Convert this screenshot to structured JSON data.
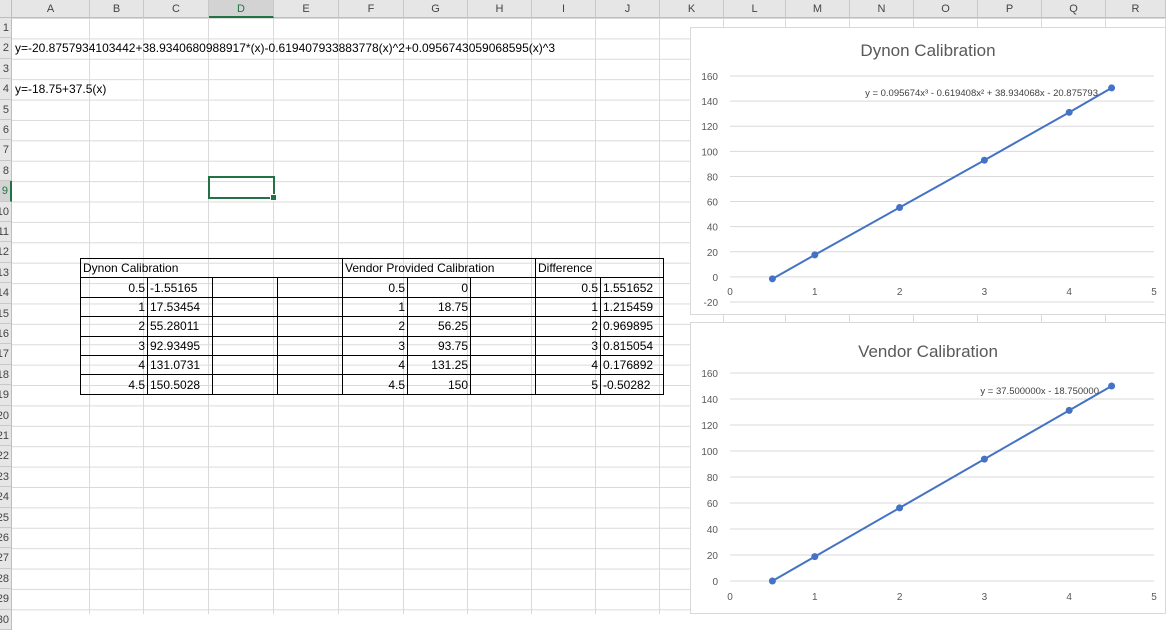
{
  "columns": [
    "A",
    "B",
    "C",
    "D",
    "E",
    "F",
    "G",
    "H",
    "I",
    "J",
    "K",
    "L",
    "M",
    "N",
    "O",
    "P",
    "Q",
    "R"
  ],
  "selected_column": "D",
  "selected_row": "9",
  "rows": [
    "1",
    "2",
    "3",
    "4",
    "5",
    "6",
    "7",
    "8",
    "9",
    "10",
    "11",
    "12",
    "13",
    "14",
    "15",
    "16",
    "17",
    "18",
    "19",
    "20",
    "21",
    "22",
    "23",
    "24",
    "25",
    "26",
    "27",
    "28",
    "29",
    "30"
  ],
  "cells": {
    "a2": "y=-20.8757934103442+38.9340680988917*(x)-0.619407933883778(x)^2+0.0956743059068595(x)^3",
    "a4": "y=-18.75+37.5(x)"
  },
  "table": {
    "headers": {
      "dynon": "Dynon Calibration",
      "vendor": "Vendor Provided Calibration",
      "diff": "Difference"
    },
    "rows": [
      {
        "b": "0.5",
        "c": "-1.55165",
        "f": "0.5",
        "g": "0",
        "i": "0.5",
        "j": "1.551652"
      },
      {
        "b": "1",
        "c": "17.53454",
        "f": "1",
        "g": "18.75",
        "i": "1",
        "j": "1.215459"
      },
      {
        "b": "2",
        "c": "55.28011",
        "f": "2",
        "g": "56.25",
        "i": "2",
        "j": "0.969895"
      },
      {
        "b": "3",
        "c": "92.93495",
        "f": "3",
        "g": "93.75",
        "i": "3",
        "j": "0.815054"
      },
      {
        "b": "4",
        "c": "131.0731",
        "f": "4",
        "g": "131.25",
        "i": "4",
        "j": "0.176892"
      },
      {
        "b": "4.5",
        "c": "150.5028",
        "f": "4.5",
        "g": "150",
        "i": "5",
        "j": "-0.50282"
      }
    ]
  },
  "chart_data": [
    {
      "type": "line",
      "title": "Dynon Calibration",
      "trendline_label": "y = 0.095674x³ - 0.619408x² + 38.934068x - 20.875793",
      "x": [
        0.5,
        1,
        2,
        3,
        4,
        4.5
      ],
      "y": [
        -1.55165,
        17.53454,
        55.28011,
        92.93495,
        131.0731,
        150.5028
      ],
      "xlim": [
        0,
        5
      ],
      "ylim": [
        -20,
        160
      ],
      "xticks": [
        "0",
        "1",
        "2",
        "3",
        "4",
        "5"
      ],
      "yticks": [
        "-20",
        "0",
        "20",
        "40",
        "60",
        "80",
        "100",
        "120",
        "140",
        "160"
      ],
      "color": "#4472c4",
      "grid": true
    },
    {
      "type": "line",
      "title": "Vendor Calibration",
      "trendline_label": "y = 37.500000x - 18.750000",
      "x": [
        0.5,
        1,
        2,
        3,
        4,
        4.5
      ],
      "y": [
        0,
        18.75,
        56.25,
        93.75,
        131.25,
        150
      ],
      "xlim": [
        0,
        5
      ],
      "ylim": [
        0,
        160
      ],
      "xticks": [
        "0",
        "1",
        "2",
        "3",
        "4",
        "5"
      ],
      "yticks": [
        "0",
        "20",
        "40",
        "60",
        "80",
        "100",
        "120",
        "140",
        "160"
      ],
      "color": "#4472c4",
      "grid": true
    }
  ]
}
